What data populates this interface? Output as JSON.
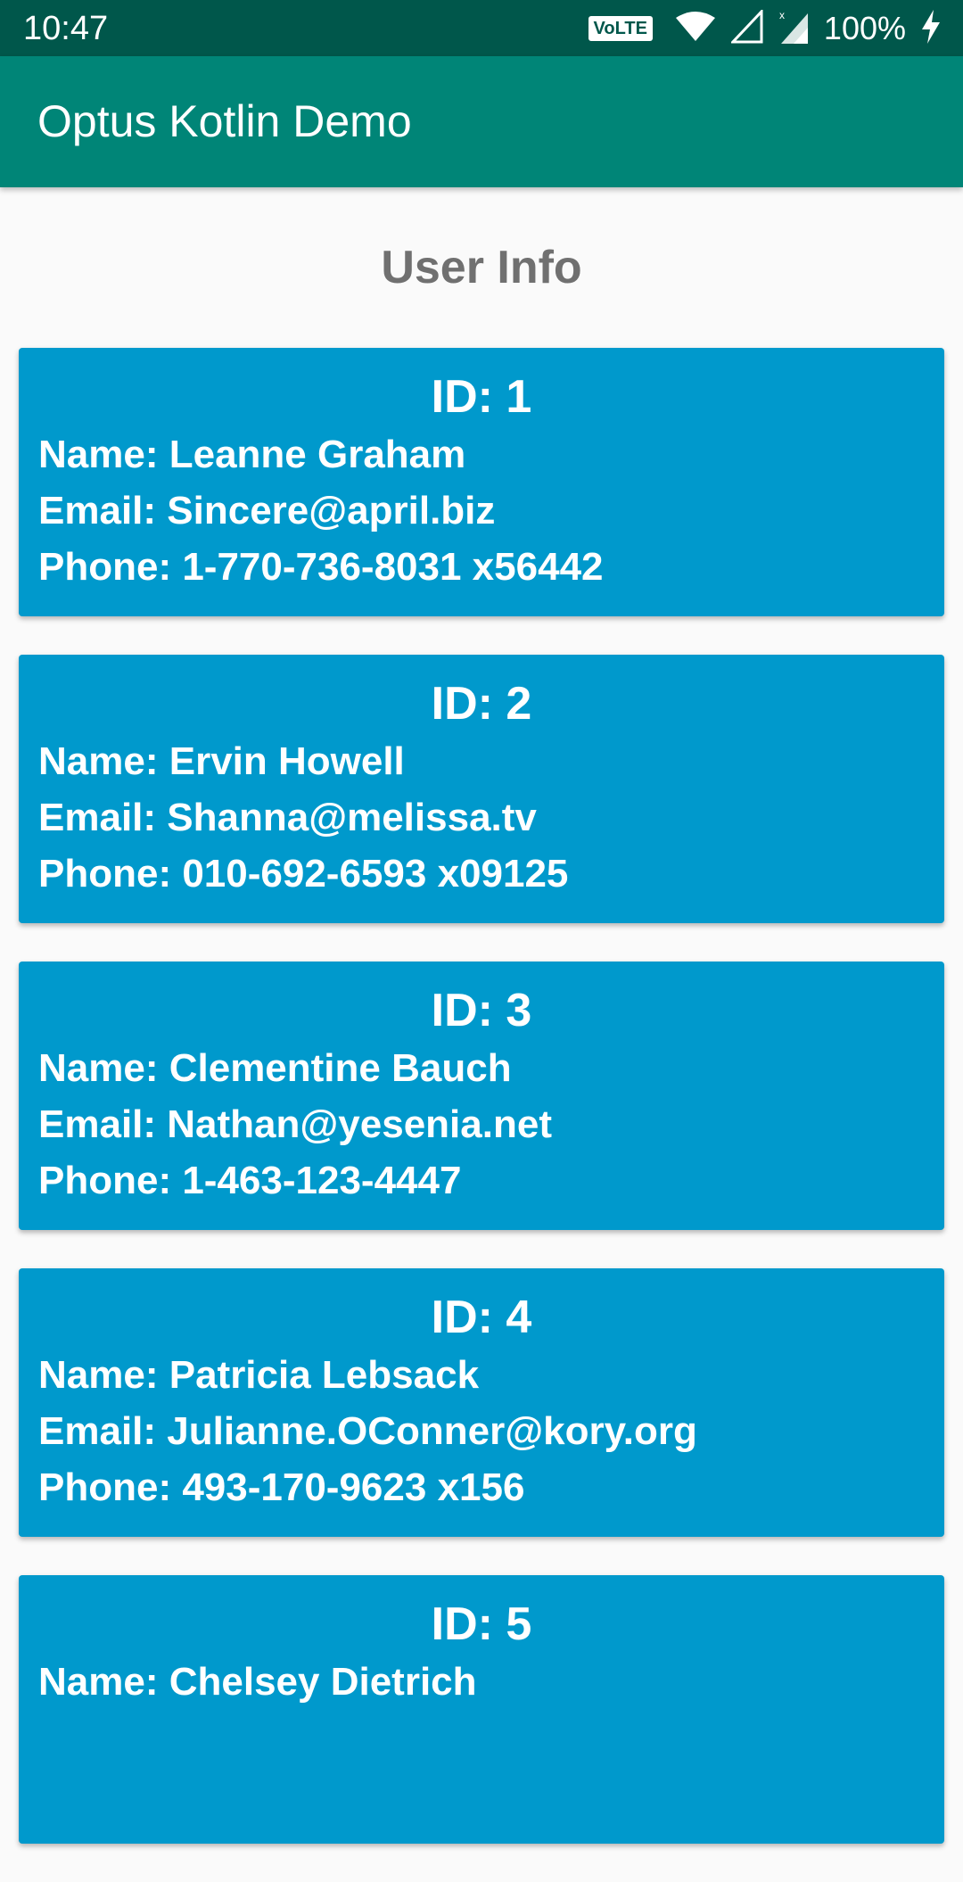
{
  "status_bar": {
    "time": "10:47",
    "volte": "VoLTE",
    "battery": "100%",
    "icons": [
      "wifi-icon",
      "signal-icon",
      "signal-x-icon",
      "charging-icon"
    ]
  },
  "app_bar": {
    "title": "Optus Kotlin Demo"
  },
  "heading": "User Info",
  "users": [
    {
      "id": "ID: 1",
      "name": "Name: Leanne Graham",
      "email": "Email: Sincere@april.biz",
      "phone": "Phone: 1-770-736-8031 x56442"
    },
    {
      "id": "ID: 2",
      "name": "Name: Ervin Howell",
      "email": "Email: Shanna@melissa.tv",
      "phone": "Phone: 010-692-6593 x09125"
    },
    {
      "id": "ID: 3",
      "name": "Name: Clementine Bauch",
      "email": "Email: Nathan@yesenia.net",
      "phone": "Phone: 1-463-123-4447"
    },
    {
      "id": "ID: 4",
      "name": "Name: Patricia Lebsack",
      "email": "Email: Julianne.OConner@kory.org",
      "phone": "Phone: 493-170-9623 x156"
    },
    {
      "id": "ID: 5",
      "name": "Name: Chelsey Dietrich",
      "email": "",
      "phone": ""
    }
  ],
  "colors": {
    "status_bar": "#00574b",
    "app_bar": "#008577",
    "card": "#0099cc",
    "heading": "#707070",
    "background": "#fafafa"
  }
}
